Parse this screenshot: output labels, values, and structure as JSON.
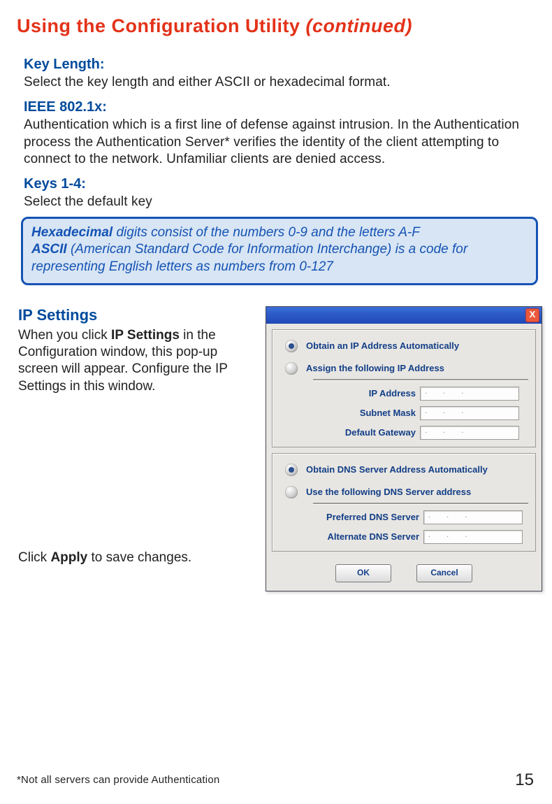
{
  "title_main": "Using the Configuration Utility ",
  "title_cont": "(continued)",
  "key_length_label": "Key Length:",
  "key_length_text": "Select the key length and either ASCII or hexadecimal format.",
  "ieee_label": "IEEE 802.1x:",
  "ieee_text": "Authentication which is a first line of defense against intrusion. In the Authentication process the Authentication Server* verifies the identity of the client attempting to connect to the network. Unfamiliar clients are denied access.",
  "keys14_label": "Keys 1-4:",
  "keys14_text": "Select the default key",
  "callout_hex_b": "Hexadecimal",
  "callout_hex_rest": " digits consist of the numbers 0-9 and the letters A-F",
  "callout_ascii_b": "ASCII",
  "callout_ascii_rest": " (American Standard Code for Information Interchange) is a code for representing English letters as numbers from 0-127",
  "ip_heading": "IP Settings",
  "ip_para_1": "When you click ",
  "ip_para_b": "IP Settings",
  "ip_para_2": " in the Configuration window, this pop-up screen will appear. Configure the IP Settings in this window.",
  "apply_1": "Click ",
  "apply_b": "Apply",
  "apply_2": " to save changes.",
  "dialog": {
    "close": "X",
    "obtain_ip": "Obtain an IP Address Automatically",
    "assign_ip": "Assign the following IP Address",
    "ip_address": "IP Address",
    "subnet": "Subnet Mask",
    "gateway": "Default Gateway",
    "obtain_dns": "Obtain DNS Server Address Automatically",
    "use_dns": "Use the following DNS Server address",
    "pref_dns": "Preferred DNS Server",
    "alt_dns": "Alternate DNS Server",
    "dots": ".  .  .",
    "ok": "OK",
    "cancel": "Cancel"
  },
  "footnote": "*Not all servers can provide Authentication",
  "pagenum": "15"
}
